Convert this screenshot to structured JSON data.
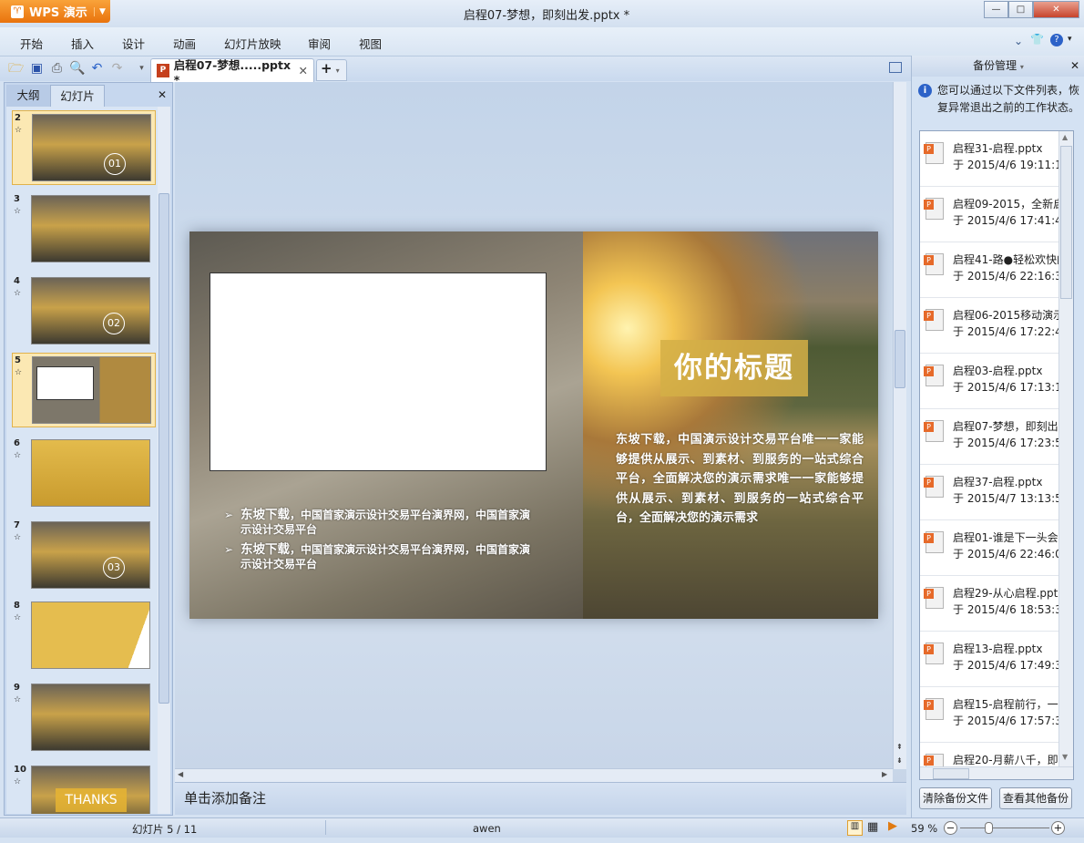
{
  "app": {
    "name": "WPS 演示",
    "title": "启程07-梦想，即刻出发.pptx *"
  },
  "window_controls": {
    "minimize": "—",
    "maximize": "□",
    "close": "✕"
  },
  "menu": [
    "开始",
    "插入",
    "设计",
    "动画",
    "幻灯片放映",
    "审阅",
    "视图"
  ],
  "toolbar": {
    "icons": [
      "open-folder-icon",
      "save-icon",
      "print-icon",
      "print-preview-icon",
      "undo-icon",
      "redo-icon",
      "customize-icon"
    ],
    "doc_tab": "启程07-梦想.....pptx *",
    "new_tab": "+"
  },
  "left_panel": {
    "tabs": [
      "大纲",
      "幻灯片"
    ],
    "selected_tab": "幻灯片",
    "thumbnails": [
      {
        "num": "2",
        "text": "01"
      },
      {
        "num": "3",
        "text": ""
      },
      {
        "num": "4",
        "text": "02"
      },
      {
        "num": "5",
        "text": ""
      },
      {
        "num": "6",
        "text": ""
      },
      {
        "num": "7",
        "text": "03"
      },
      {
        "num": "8",
        "text": ""
      },
      {
        "num": "9",
        "text": ""
      },
      {
        "num": "10",
        "text": "THANKS"
      }
    ],
    "selected": "5"
  },
  "slide": {
    "title": "你的标题",
    "body": "东坡下载，中国演示设计交易平台唯一一家能够提供从展示、到素材、到服务的一站式综合平台，全面解决您的演示需求唯一一家能够提供从展示、到素材、到服务的一站式综合平台，全面解决您的演示需求",
    "bullets": [
      {
        "lead": "东坡下载",
        "rest": "，中国首家演示设计交易平台演界网，中国首家演示设计交易平台"
      },
      {
        "lead": "东坡下载",
        "rest": "，中国首家演示设计交易平台演界网，中国首家演示设计交易平台"
      }
    ]
  },
  "notes_placeholder": "单击添加备注",
  "backup_panel": {
    "title": "备份管理",
    "info": "您可以通过以下文件列表，恢复异常退出之前的工作状态。",
    "items": [
      {
        "name": "启程31-启程.pptx",
        "time": "于 2015/4/6 19:11:1"
      },
      {
        "name": "启程09-2015，全新启",
        "time": "于 2015/4/6 17:41:4"
      },
      {
        "name": "启程41-路●轻松欢快的",
        "time": "于 2015/4/6 22:16:3"
      },
      {
        "name": "启程06-2015移动演示",
        "time": "于 2015/4/6 17:22:4"
      },
      {
        "name": "启程03-启程.pptx",
        "time": "于 2015/4/6 17:13:1"
      },
      {
        "name": "启程07-梦想，即刻出",
        "time": "于 2015/4/6 17:23:5"
      },
      {
        "name": "启程37-启程.pptx",
        "time": "于 2015/4/7 13:13:5"
      },
      {
        "name": "启程01-谁是下一头会",
        "time": "于 2015/4/6 22:46:0"
      },
      {
        "name": "启程29-从心启程.pptx",
        "time": "于 2015/4/6 18:53:3"
      },
      {
        "name": "启程13-启程.pptx",
        "time": "于 2015/4/6 17:49:3"
      },
      {
        "name": "启程15-启程前行，一",
        "time": "于 2015/4/6 17:57:3"
      },
      {
        "name": "启程20-月薪八千，即",
        "time": ""
      }
    ],
    "buttons": [
      "清除备份文件",
      "查看其他备份"
    ]
  },
  "status": {
    "slide": "幻灯片 5 / 11",
    "author": "awen",
    "zoom": "59 %",
    "zoom_percent": 59
  }
}
